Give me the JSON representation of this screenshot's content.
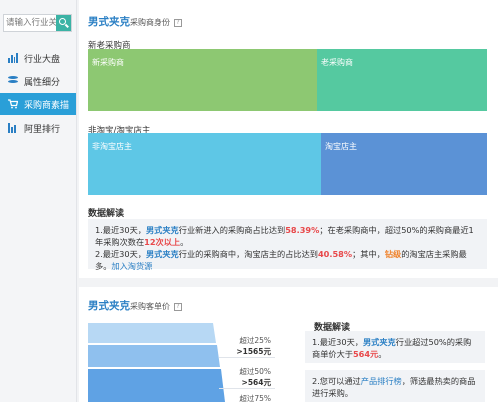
{
  "search": {
    "placeholder": "请输入行业关键"
  },
  "sidebar": {
    "items": [
      {
        "label": "行业大盘",
        "icon": "bar-chart-icon",
        "active": false
      },
      {
        "label": "属性细分",
        "icon": "database-icon",
        "active": false
      },
      {
        "label": "采购商素描",
        "icon": "cart-icon",
        "active": true
      },
      {
        "label": "阿里排行",
        "icon": "ranking-icon",
        "active": false
      }
    ]
  },
  "identity_panel": {
    "title": "男式夹克",
    "subtitle": "采购商身份",
    "help": "?",
    "group1": {
      "label": "新老采购商",
      "segments": [
        {
          "label": "新采购商",
          "share": 0.5839,
          "color": "#8dc872"
        },
        {
          "label": "老采购商",
          "share": 0.4161,
          "color": "#55c9a0"
        }
      ]
    },
    "group2": {
      "label": "非淘宝/淘宝店主",
      "segments": [
        {
          "label": "非淘宝店主",
          "share": 0.5942,
          "color": "#5ec7e6"
        },
        {
          "label": "淘宝店主",
          "share": 0.4058,
          "color": "#5b92d6"
        }
      ]
    },
    "interpretation": {
      "heading": "数据解读",
      "line1_prefix": "1.最近30天，",
      "line1_industry": "男式夹克",
      "line1_mid": "行业新进入的采购商占比达到",
      "line1_value": "58.39%",
      "line1_mid2": "；在老采购商中，超过50%的采购商最近1年采购次数在",
      "line1_count": "12次以上",
      "line1_end": "。",
      "line2_prefix": "2.最近30天，",
      "line2_industry": "男式夹克",
      "line2_mid": "行业的采购商中，淘宝店主的占比达到",
      "line2_value": "40.58%",
      "line2_mid2": "；其中，",
      "line2_level": "钻级",
      "line2_end": "的淘宝店主采购最多。",
      "line2_link": "加入淘货源"
    }
  },
  "price_panel": {
    "title": "男式夹克",
    "subtitle": "采购客单价",
    "help": "?",
    "thresholds": [
      {
        "label": "超过25%",
        "value": ">1565元"
      },
      {
        "label": "超过50%",
        "value": ">564元"
      },
      {
        "label": "超过75%",
        "value": ""
      }
    ],
    "interpretation": {
      "heading": "数据解读",
      "line1_prefix": "1.最近30天，",
      "line1_industry": "男式夹克",
      "line1_mid": "行业超过50%的采购商单价大于",
      "line1_value": "564元",
      "line1_end": "。",
      "line2_prefix": "2.您可以通过",
      "line2_link": "产品排行榜",
      "line2_end": "，筛选最热卖的商品进行采购。"
    }
  },
  "colors": {
    "accent": "#2a7fc4",
    "search_button": "#3bb3a5",
    "active_nav": "#2a9fd8",
    "highlight_red": "#e8484a"
  }
}
